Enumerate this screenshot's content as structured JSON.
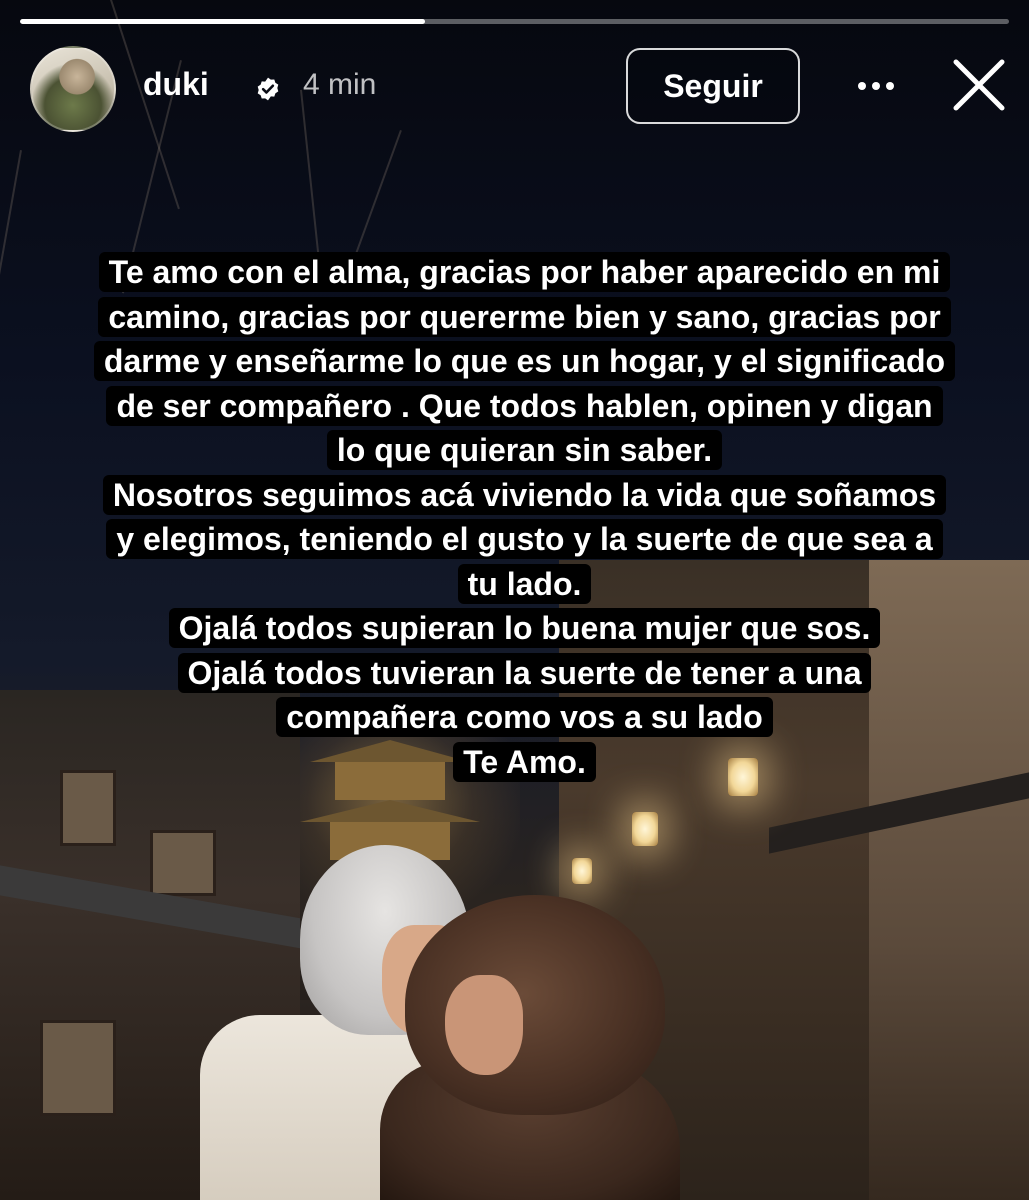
{
  "story": {
    "progress_fraction": 0.41,
    "user": {
      "username": "duki",
      "verified": true,
      "time_ago": "4 min"
    },
    "actions": {
      "follow_label": "Seguir",
      "more_icon": "more-horizontal-icon",
      "close_icon": "close-icon"
    },
    "caption_lines": [
      "Te amo con el alma, gracias por haber aparecido en mi",
      "camino, gracias por quererme bien y sano, gracias por",
      "darme y enseñarme lo que es un hogar, y el significado",
      "de ser compañero . Que todos hablen, opinen y digan",
      "lo que quieran sin saber.",
      "Nosotros seguimos acá viviendo la vida  que soñamos",
      "y elegimos, teniendo el gusto y la suerte de que sea a",
      "tu lado.",
      "Ojalá todos supieran lo buena mujer que sos.",
      "Ojalá todos tuvieran la suerte de tener a una",
      "compañera como vos a su lado",
      "Te Amo."
    ],
    "colors": {
      "text": "#ffffff",
      "caption_background": "#000000",
      "verified_badge": "#ffffff"
    }
  }
}
